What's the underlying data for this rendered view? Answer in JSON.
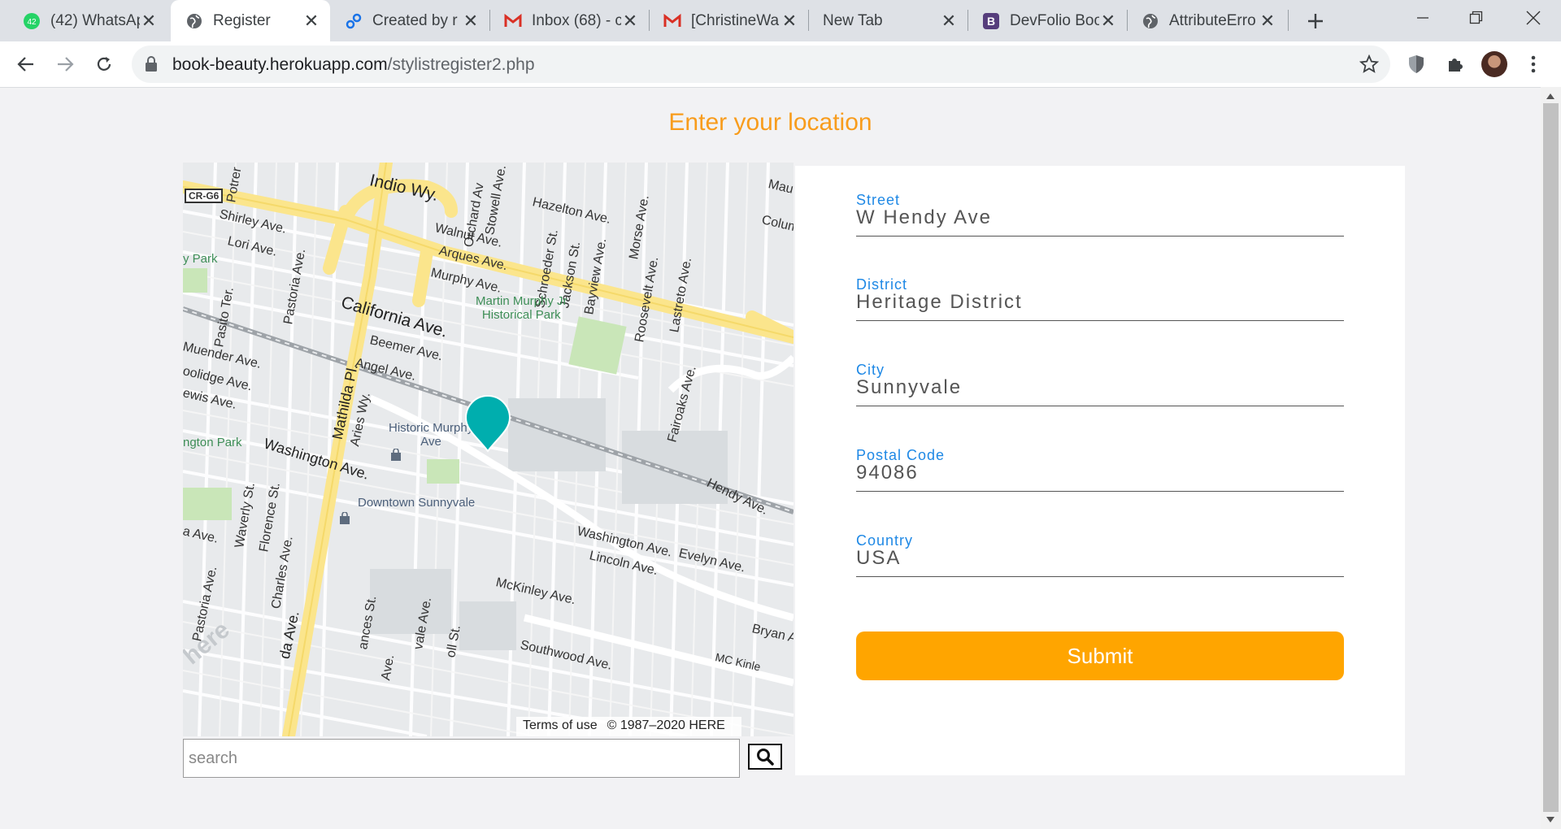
{
  "browser": {
    "tabs": [
      {
        "title": "(42) WhatsAp",
        "icon": "whatsapp-icon",
        "badge": "42",
        "active": false
      },
      {
        "title": "Register",
        "icon": "globe-icon",
        "active": true
      },
      {
        "title": "Created by r",
        "icon": "link-icon",
        "active": false
      },
      {
        "title": "Inbox (68) - c",
        "icon": "gmail-icon",
        "active": false
      },
      {
        "title": "[ChristineWa",
        "icon": "gmail-icon",
        "active": false
      },
      {
        "title": "New Tab",
        "icon": "",
        "active": false
      },
      {
        "title": "DevFolio Boo",
        "icon": "bootstrap-icon",
        "active": false
      },
      {
        "title": "AttributeErro",
        "icon": "globe-icon",
        "active": false
      }
    ],
    "url_host": "book-beauty.herokuapp.com",
    "url_path": "/stylistregister2.php",
    "colors": {
      "tabstrip": "#dee1e6",
      "omnibox": "#f1f3f4"
    }
  },
  "page": {
    "heading": "Enter your location",
    "heading_color": "#f89c1c",
    "search": {
      "placeholder": "search"
    },
    "map": {
      "credit_terms": "Terms of use",
      "credit_copyright": "© 1987–2020 HERE",
      "shield": "CR-G6",
      "watermark": "here",
      "labels": {
        "indio": "Indio Wy.",
        "california": "California Ave.",
        "hazelton": "Hazelton Ave.",
        "walnut": "Walnut Ave.",
        "arques": "Arques Ave.",
        "murphy": "Murphy Ave.",
        "shirley": "Shirley Ave.",
        "lori": "Lori Ave.",
        "park_left": "y Park",
        "pastoria": "Pastoria Ave.",
        "pasito": "Pasito Ter.",
        "potrero": "Potrer",
        "orchard": "Orchard Av",
        "stowell": "Stowell Ave.",
        "schroeder": "Schroeder St.",
        "jackson": "Jackson St.",
        "bayview": "Bayview Ave.",
        "morse": "Morse Ave.",
        "roosevelt": "Roosevelt Ave.",
        "lastreto": "Lastreto Ave.",
        "mau": "Mau",
        "colum": "Colum",
        "martin_park": "Martin Murphy Jr\nHistorical Park",
        "beemer": "Beemer Ave.",
        "angel": "Angel Ave.",
        "muender": "Muender Ave.",
        "coolidge": "oolidge Ave.",
        "lewis": "ewis Ave.",
        "mathilda": "Mathilda Pl.",
        "aries": "Aries Wy.",
        "historic_murphy": "Historic Murphy\nAve",
        "washington_w": "Washington Ave.",
        "washington_e": "Washington Ave.",
        "ngton_park": "ngton Park",
        "downtown": "Downtown Sunnyvale",
        "hendy": "Hendy Ave.",
        "fairoaks": "Fairoaks Ave.",
        "lincoln": "Lincoln Ave.",
        "evelyn": "Evelyn Ave.",
        "mckinley": "McKinley Ave.",
        "southwood": "Southwood Ave.",
        "bryan": "Bryan A",
        "mckinley2": "MC Kinle",
        "waverly": "Waverly St.",
        "florence": "Florence St.",
        "charles": "Charles Ave.",
        "pastoria2": "Pastoria Ave.",
        "la_ave_left": "a Ave.",
        "ida_ave": "da Ave.",
        "frances": "ances St.",
        "sunnyvale_ave": "vale Ave.",
        "toll": "oll St.",
        "ave_small": "Ave."
      },
      "marker_color": "#00aeae"
    },
    "form": {
      "fields": [
        {
          "label": "Street",
          "value": "W Hendy Ave"
        },
        {
          "label": "District",
          "value": "Heritage District"
        },
        {
          "label": "City",
          "value": "Sunnyvale"
        },
        {
          "label": "Postal Code",
          "value": "94086"
        },
        {
          "label": "Country",
          "value": "USA"
        }
      ],
      "submit_label": "Submit",
      "submit_color": "#ffa500",
      "label_color": "#1e88e5"
    }
  }
}
